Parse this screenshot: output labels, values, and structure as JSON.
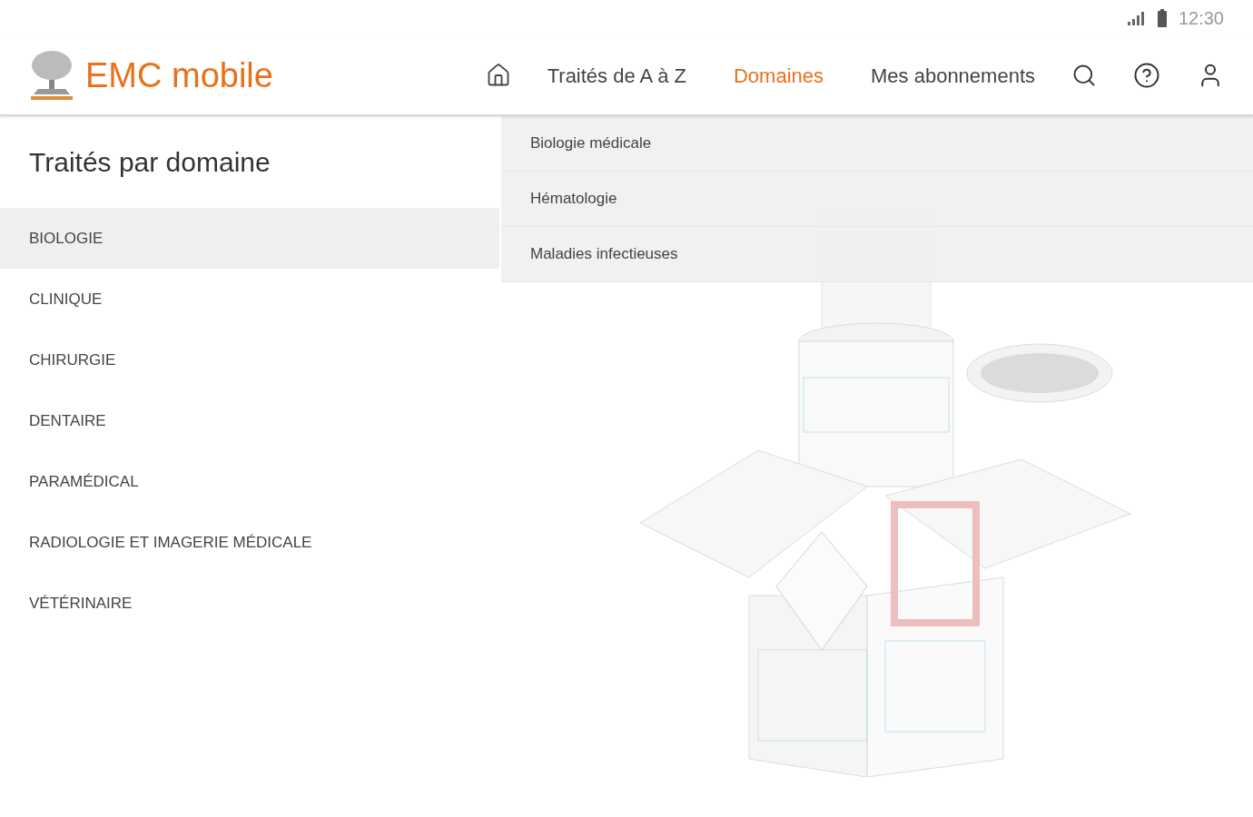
{
  "status_bar": {
    "time": "12:30"
  },
  "header": {
    "app_title": "EMC mobile",
    "nav": [
      {
        "label": "Traités de A à Z",
        "selected": false
      },
      {
        "label": "Domaines",
        "selected": true
      },
      {
        "label": "Mes abonnements",
        "selected": false
      }
    ]
  },
  "sidebar": {
    "title": "Traités par domaine",
    "items": [
      {
        "label": "BIOLOGIE",
        "selected": true
      },
      {
        "label": "CLINIQUE",
        "selected": false
      },
      {
        "label": "CHIRURGIE",
        "selected": false
      },
      {
        "label": "DENTAIRE",
        "selected": false
      },
      {
        "label": "PARAMÉDICAL",
        "selected": false
      },
      {
        "label": "RADIOLOGIE ET IMAGERIE MÉDICALE",
        "selected": false
      },
      {
        "label": "VÉTÉRINAIRE",
        "selected": false
      }
    ]
  },
  "submenu": {
    "items": [
      {
        "label": "Biologie médicale"
      },
      {
        "label": "Hématologie"
      },
      {
        "label": "Maladies infectieuses"
      }
    ]
  }
}
